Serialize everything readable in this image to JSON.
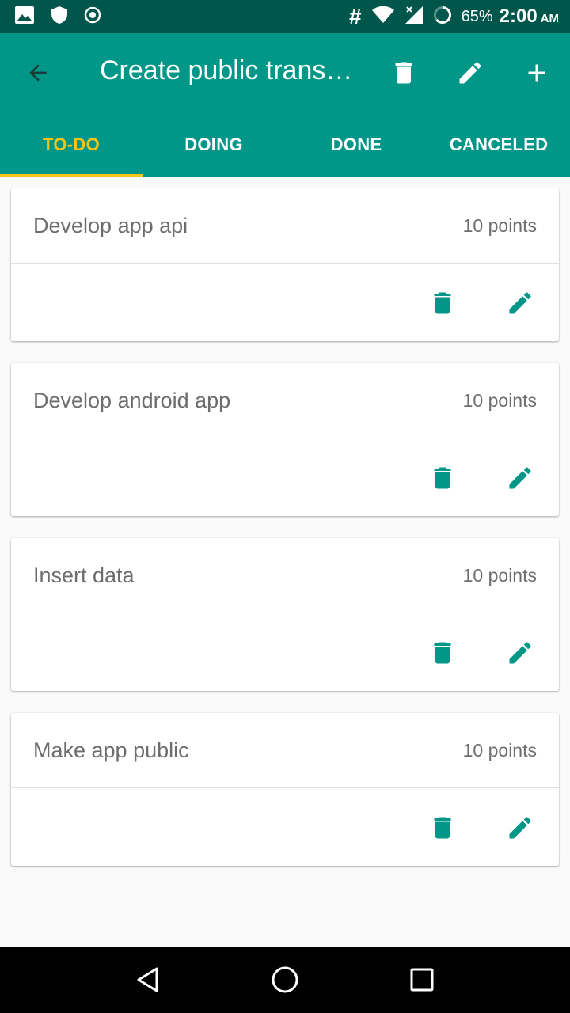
{
  "status_bar": {
    "battery_percent": "65%",
    "time": "2:00",
    "ampm": "AM",
    "hash": "#"
  },
  "toolbar": {
    "title": "Create public trans…",
    "back_icon": "arrow-back-icon",
    "delete_icon": "trash-icon",
    "edit_icon": "pencil-icon",
    "add_icon": "plus-icon"
  },
  "tabs": [
    {
      "label": "TO-DO",
      "active": true
    },
    {
      "label": "DOING",
      "active": false
    },
    {
      "label": "DONE",
      "active": false
    },
    {
      "label": "CANCELED",
      "active": false
    }
  ],
  "tasks": [
    {
      "name": "Develop app api",
      "points": "10 points"
    },
    {
      "name": "Develop android app",
      "points": "10 points"
    },
    {
      "name": "Insert data",
      "points": "10 points"
    },
    {
      "name": "Make app public",
      "points": "10 points"
    }
  ],
  "colors": {
    "primary": "#009688",
    "primary_dark": "#00564a",
    "accent": "#f5c518"
  }
}
